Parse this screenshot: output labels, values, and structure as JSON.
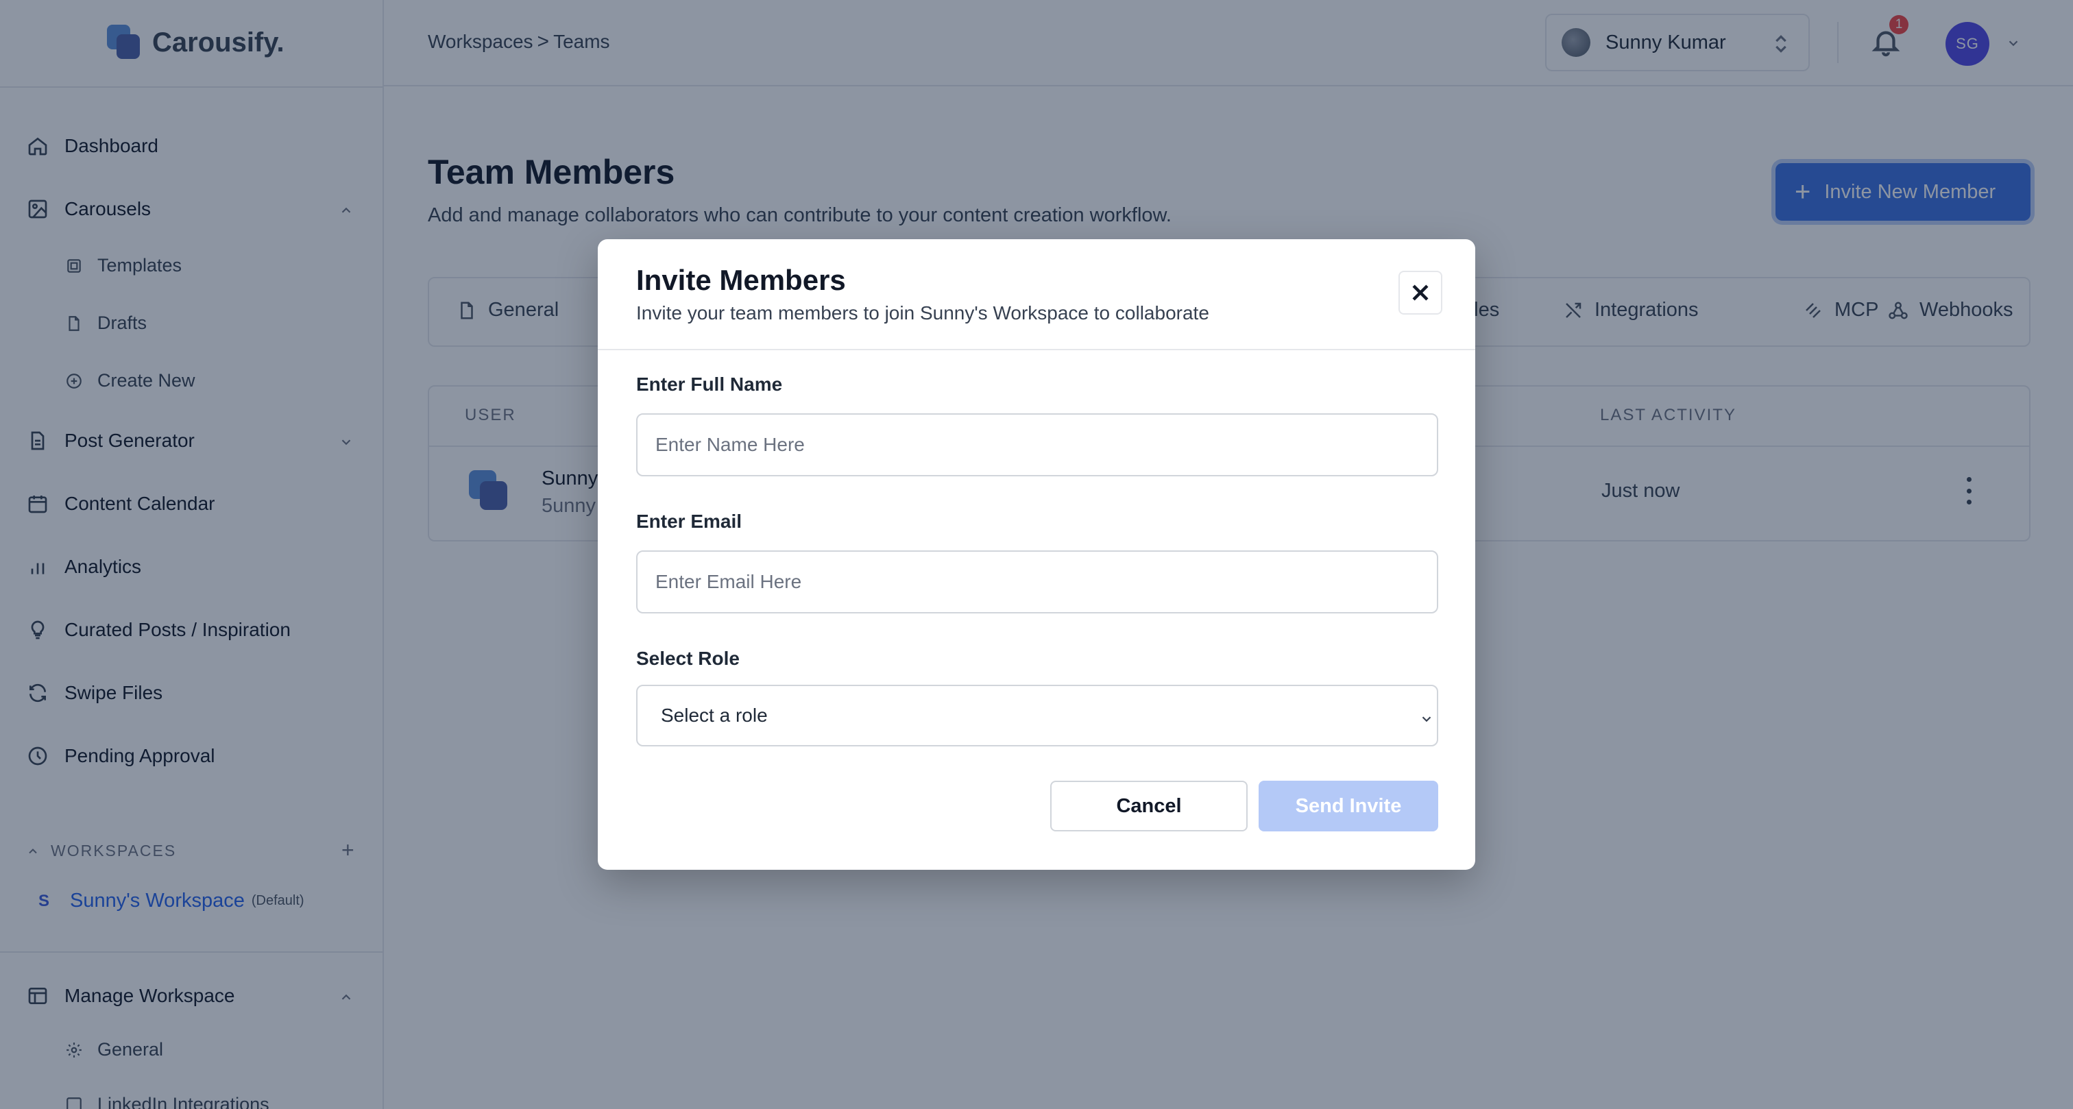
{
  "app": {
    "name": "Carousify."
  },
  "breadcrumb": {
    "parent": "Workspaces",
    "separator": ">",
    "current": "Teams"
  },
  "topbar": {
    "user_name": "Sunny Kumar",
    "notification_count": "1",
    "avatar_initials": "SG"
  },
  "sidebar": {
    "items": [
      {
        "label": "Dashboard",
        "icon": "home-icon"
      },
      {
        "label": "Carousels",
        "icon": "image-icon",
        "expanded": true,
        "children": [
          {
            "label": "Templates",
            "icon": "template-icon"
          },
          {
            "label": "Drafts",
            "icon": "file-icon"
          },
          {
            "label": "Create New",
            "icon": "plus-circle-icon"
          }
        ]
      },
      {
        "label": "Post Generator",
        "icon": "document-icon",
        "expanded": false
      },
      {
        "label": "Content Calendar",
        "icon": "calendar-icon"
      },
      {
        "label": "Analytics",
        "icon": "bar-chart-icon"
      },
      {
        "label": "Curated Posts / Inspiration",
        "icon": "lightbulb-icon"
      },
      {
        "label": "Swipe Files",
        "icon": "refresh-icon"
      },
      {
        "label": "Pending Approval",
        "icon": "clock-icon"
      }
    ],
    "workspaces_header": "WORKSPACES",
    "workspace": {
      "initial": "S",
      "name": "Sunny's Workspace",
      "tag": "(Default)"
    },
    "manage": {
      "label": "Manage Workspace",
      "children": [
        {
          "label": "General"
        },
        {
          "label": "LinkedIn Integrations"
        }
      ]
    }
  },
  "main": {
    "title": "Team Members",
    "subtitle": "Add and manage collaborators who can contribute to your content creation workflow.",
    "invite_button": "Invite New Member",
    "tabs": [
      {
        "label": "General",
        "icon": "file-icon"
      },
      {
        "label": "oles",
        "icon": ""
      },
      {
        "label": "Integrations",
        "icon": "shuffle-icon"
      },
      {
        "label": "MCP",
        "icon": "mcp-icon"
      },
      {
        "label": "Webhooks",
        "icon": "webhook-icon"
      }
    ],
    "table": {
      "columns": {
        "user": "USER",
        "last_activity": "LAST ACTIVITY"
      },
      "rows": [
        {
          "name": "Sunny",
          "email": "5unny",
          "last_activity": "Just now"
        }
      ]
    }
  },
  "modal": {
    "title": "Invite Members",
    "subtitle": "Invite your team members to join Sunny's Workspace to collaborate",
    "name_label": "Enter Full Name",
    "name_placeholder": "Enter Name Here",
    "email_label": "Enter Email",
    "email_placeholder": "Enter Email Here",
    "role_label": "Select Role",
    "role_value": "Select a role",
    "cancel": "Cancel",
    "send": "Send Invite"
  },
  "colors": {
    "accent": "#3b6fe0",
    "send_disabled": "#b4c9f7",
    "badge": "#ef4444",
    "avatar": "#4f46e5",
    "overlay": "rgba(17,34,60,0.48)"
  }
}
